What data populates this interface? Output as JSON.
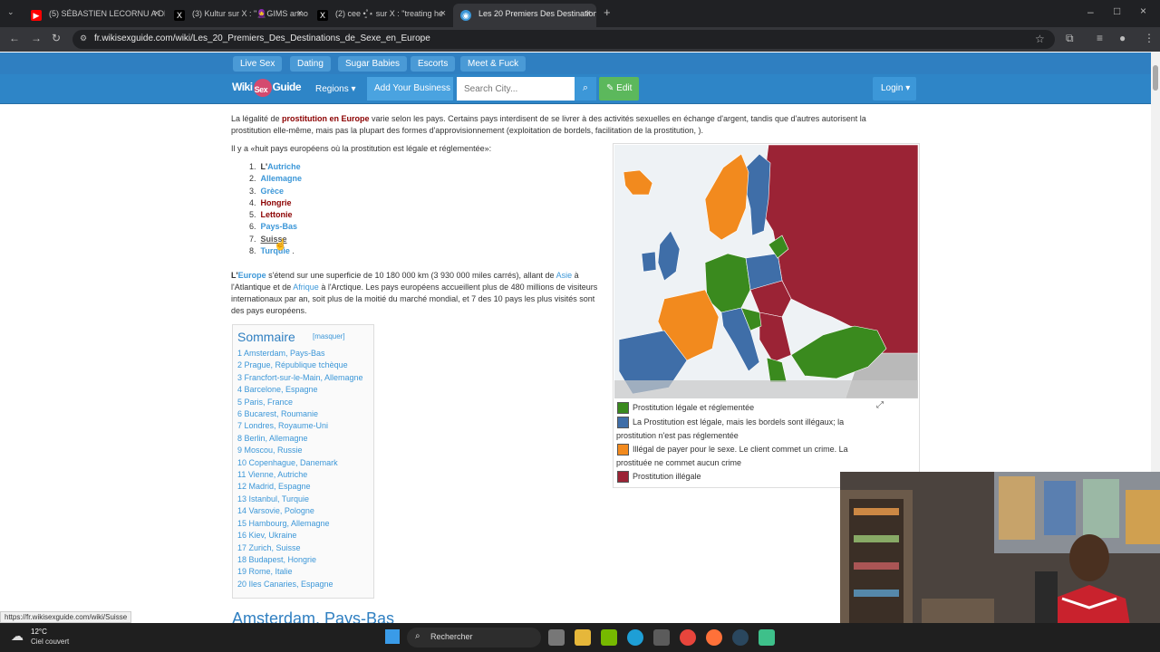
{
  "browser": {
    "tabs": [
      {
        "title": "(5) SÉBASTIEN LECORNU A DÉN",
        "icon": "youtube-icon",
        "color": "#ff0000"
      },
      {
        "title": "(3) Kultur sur X : \"🧕GIMS anno",
        "icon": "x-icon",
        "color": "#000000"
      },
      {
        "title": "(2) cee •͈˚⋆ sur X : \"treating he",
        "icon": "x-icon",
        "color": "#000000"
      },
      {
        "title": "Les 20 Premiers Des Destination",
        "icon": "globe-icon",
        "color": "#3c97d8"
      }
    ],
    "url": "fr.wikisexguide.com/wiki/Les_20_Premiers_Des_Destinations_de_Sexe_en_Europe"
  },
  "site": {
    "top_nav": [
      "Live Sex",
      "Dating",
      "Sugar Babies",
      "Escorts",
      "Meet & Fuck"
    ],
    "logo_left": "Wiki",
    "logo_mid": "Sex",
    "logo_right": "Guide",
    "regions_label": "Regions ▾",
    "add_business": "Add Your Business",
    "search_placeholder": "Search City...",
    "edit_label": "✎ Edit",
    "login_label": "Login ▾"
  },
  "article": {
    "intro_1a": "La légalité de ",
    "intro_1_bold": "prostitution en Europe",
    "intro_1b": " varie selon les pays. Certains pays interdisent de se livrer à des activités sexuelles en échange d'argent, tandis que d'autres autorisent la",
    "intro_2": "prostitution elle-même, mais pas la plupart des formes d'approvisionnement (exploitation de bordels, facilitation de la prostitution, ).",
    "intro_3": "Il y a «huit pays européens où la prostitution est légale et réglementée»:",
    "countries": [
      {
        "num": "1.",
        "prefix": "L'",
        "name": "Autriche",
        "style": "lnkb"
      },
      {
        "num": "2.",
        "prefix": "",
        "name": "Allemagne",
        "style": "lnkb"
      },
      {
        "num": "3.",
        "prefix": "",
        "name": "Grèce",
        "style": "lnkb"
      },
      {
        "num": "4.",
        "prefix": "",
        "name": "Hongrie",
        "style": "red"
      },
      {
        "num": "5.",
        "prefix": "",
        "name": "Lettonie",
        "style": "red"
      },
      {
        "num": "6.",
        "prefix": "",
        "name": "Pays-Bas",
        "style": "lnkb"
      },
      {
        "num": "7.",
        "prefix": "",
        "name": "Suisse",
        "style": "lnkb"
      },
      {
        "num": "8.",
        "prefix": "",
        "name": "Turquie",
        "style": "lnkb",
        "suffix": " ."
      }
    ],
    "europe_1a": "L'",
    "europe_1_link": "Europe",
    "europe_1b": " s'étend sur une superficie de 10 180 000 km (3 930 000 miles carrés), allant de ",
    "europe_1_link2": "Asie",
    "europe_1c": " à",
    "europe_2a": "l'Atlantique et de ",
    "europe_2_link": "Afrique",
    "europe_2b": " à l'Arctique. Les pays européens accueillent plus de 480 millions de visiteurs",
    "europe_3": "internationaux par an, soit plus de la moitié du marché mondial, et 7 des 10 pays les plus visités sont",
    "europe_4": "des pays européens.",
    "toc_title": "Sommaire",
    "toc_hide": "[masquer]",
    "toc": [
      "1 Amsterdam, Pays-Bas",
      "2 Prague, République tchèque",
      "3 Francfort-sur-le-Main, Allemagne",
      "4 Barcelone, Espagne",
      "5 Paris, France",
      "6 Bucarest, Roumanie",
      "7 Londres, Royaume-Uni",
      "8 Berlin, Allemagne",
      "9 Moscou, Russie",
      "10 Copenhague, Danemark",
      "11 Vienne, Autriche",
      "12 Madrid, Espagne",
      "13 Istanbul, Turquie",
      "14 Varsovie, Pologne",
      "15 Hambourg, Allemagne",
      "16 Kiev, Ukraine",
      "17 Zurich, Suisse",
      "18 Budapest, Hongrie",
      "19 Rome, Italie",
      "20 Iles Canaries, Espagne"
    ],
    "heading": "Amsterdam, Pays-Bas"
  },
  "map_legend": [
    {
      "color": "#3a8a1e",
      "lines": [
        "Prostitution légale et réglementée"
      ]
    },
    {
      "color": "#3f6ea8",
      "lines": [
        "La Prostitution est légale, mais les bordels sont illégaux; la",
        "prostitution n'est pas réglementée"
      ]
    },
    {
      "color": "#f28a1e",
      "lines": [
        "Illégal de payer pour le sexe. Le client commet un crime. La",
        "prostituée ne commet aucun crime"
      ]
    },
    {
      "color": "#9b2335",
      "lines": [
        "Prostitution illégale"
      ]
    }
  ],
  "status_url": "https://fr.wikisexguide.com/wiki/Suisse",
  "taskbar": {
    "temp": "12°C",
    "weather": "Ciel couvert",
    "search": "Rechercher"
  }
}
